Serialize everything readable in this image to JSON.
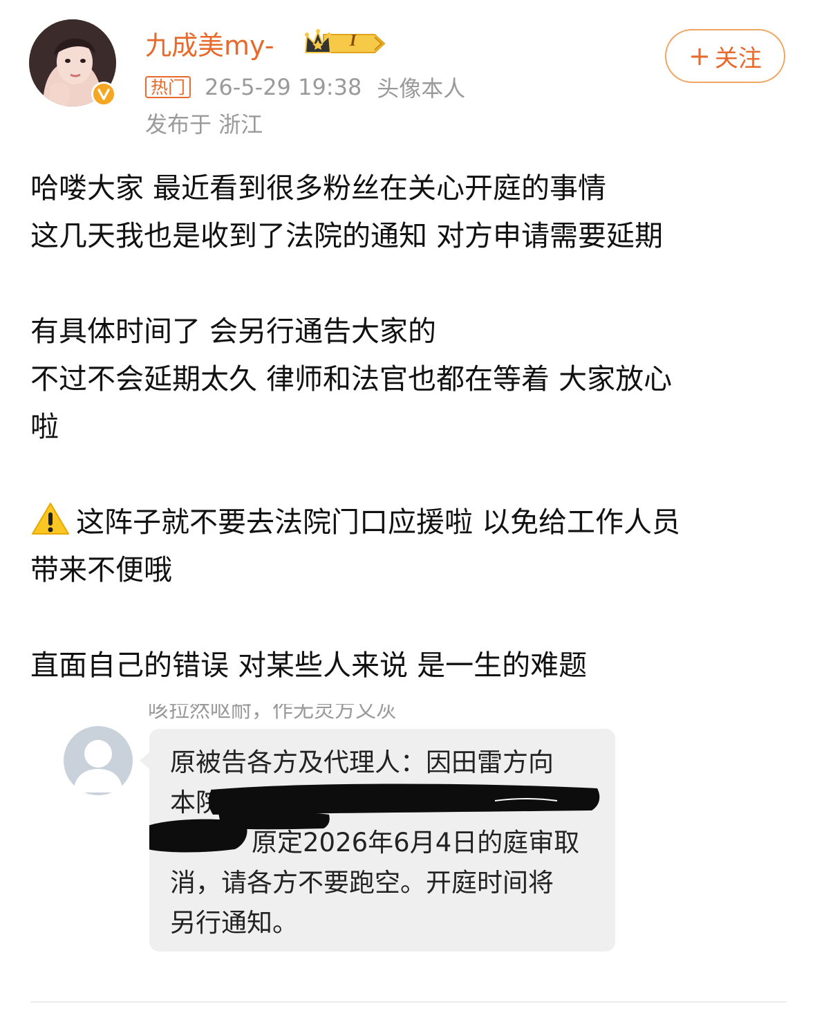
{
  "header": {
    "username": "九成美my-",
    "badge_level": "I",
    "hot_tag": "热门",
    "timestamp": "26-5-29 19:38",
    "source": "头像本人",
    "location": "发布于 浙江",
    "follow_label": "关注",
    "follow_icon": "+"
  },
  "post": {
    "lines": [
      "哈喽大家 最近看到很多粉丝在关心开庭的事情",
      "这几天我也是收到了法院的通知 对方申请需要延期",
      "有具体时间了 会另行通告大家的",
      "不过不会延期太久 律师和法官也都在等着 大家放心",
      "啦",
      "这阵子就不要去法院门口应援啦 以免给工作人员",
      "带来不便哦",
      "直面自己的错误 对某些人来说 是一生的难题"
    ]
  },
  "sms": {
    "cut_text": "咳拉然呕耐，作无灵方又灰",
    "lines": [
      "原被告各方及代理人：因田雷方向",
      "本院",
      "原定2026年6月4日的庭审取",
      "消，请各方不要跑空。开庭时间将",
      "另行通知。"
    ]
  },
  "colors": {
    "accent": "#e8692c",
    "meta_gray": "#9a9a9a",
    "verified": "#f5a623",
    "bubble": "#efefef"
  },
  "icons": {
    "verified": "verified-v-icon",
    "crown": "crown-icon",
    "warning": "warning-icon",
    "sms_avatar": "default-person-icon"
  }
}
